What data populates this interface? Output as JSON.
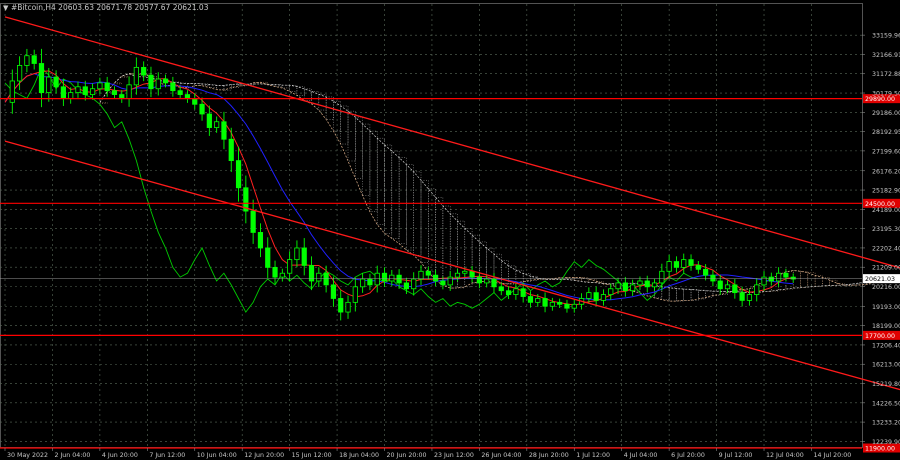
{
  "header": {
    "symbol_info": "#Bitcoin,H4  20603.63 20671.78 20577.67 20621.03"
  },
  "colors": {
    "background": "#000000",
    "grid": "#5a6a5a",
    "axis_text": "#c8c8c8",
    "level_line": "#ff0000",
    "channel_line": "#ff1a1a",
    "bull_candle": "#00ff00",
    "bear_candle": "#00ff00",
    "chikou": "#00cc00",
    "tenkan": "#ff2020",
    "kijun": "#2020ff",
    "cloud_a": "#e8b890",
    "cloud_b": "#d8d8d8",
    "current_price_box": "#ffffff",
    "level_box": "#e00000"
  },
  "chart_data": {
    "type": "candlestick",
    "instrument": "#Bitcoin",
    "timeframe": "H4",
    "ohlc_last": {
      "open": 20603.63,
      "high": 20671.78,
      "low": 20577.67,
      "close": 20621.03
    },
    "y_range": [
      11900,
      34300
    ],
    "y_ticks": [
      33159.96,
      32166.91,
      31172.88,
      30179.5,
      29186.0,
      28192.95,
      27199.6,
      26176.2,
      25182.9,
      24189.0,
      23195.3,
      22202.4,
      21209.0,
      20216.0,
      19193.0,
      18199.0,
      17206.4,
      16213.0,
      15219.8,
      14226.5,
      13233.2,
      12239.9
    ],
    "y_tick_labels": [
      "33159.96",
      "32166.91",
      "31172.88",
      "30179.50",
      "29186.00",
      "28192.95",
      "27199.60",
      "26176.20",
      "25182.90",
      "24189.00",
      "23195.30",
      "22202.40",
      "21209.00",
      "20216.00",
      "19193.00",
      "18199.00",
      "17206.40",
      "16213.00",
      "15219.80",
      "14226.50",
      "13233.20",
      "12239.90"
    ],
    "current_price": 20621.03,
    "current_price_label": "20621.03",
    "horizontal_levels": [
      {
        "price": 29890.0,
        "label": "29890.00"
      },
      {
        "price": 24500.0,
        "label": "24500.00"
      },
      {
        "price": 17700.0,
        "label": "17700.00"
      },
      {
        "price": 11900.0,
        "label": "11900.00"
      }
    ],
    "x_tick_labels": [
      "30 May 2022",
      "2 Jun 04:00",
      "4 Jun 20:00",
      "7 Jun 12:00",
      "10 Jun 04:00",
      "12 Jun 20:00",
      "15 Jun 12:00",
      "18 Jun 04:00",
      "20 Jun 20:00",
      "23 Jun 12:00",
      "26 Jun 04:00",
      "28 Jun 20:00",
      "1 Jul 12:00",
      "4 Jul 04:00",
      "6 Jul 20:00",
      "9 Jul 12:00",
      "12 Jul 04:00",
      "14 Jul 20:00"
    ],
    "x_domain": [
      0,
      228
    ],
    "x_tick_positions": [
      0,
      13,
      26,
      39,
      52,
      65,
      78,
      91,
      104,
      117,
      130,
      143,
      156,
      169,
      182,
      195,
      208,
      221
    ],
    "trend_lines": [
      {
        "name": "upper-channel",
        "points": [
          [
            0,
            34100
          ],
          [
            260,
            20400
          ]
        ]
      },
      {
        "name": "lower-channel",
        "points": [
          [
            0,
            27700
          ],
          [
            255,
            14400
          ]
        ]
      }
    ],
    "close_path": [
      [
        0,
        29700
      ],
      [
        2,
        30800
      ],
      [
        4,
        31600
      ],
      [
        6,
        32100
      ],
      [
        8,
        31700
      ],
      [
        10,
        30200
      ],
      [
        12,
        31000
      ],
      [
        14,
        30500
      ],
      [
        16,
        29900
      ],
      [
        18,
        30200
      ],
      [
        20,
        30500
      ],
      [
        22,
        30100
      ],
      [
        24,
        30400
      ],
      [
        26,
        30700
      ],
      [
        28,
        30300
      ],
      [
        30,
        30100
      ],
      [
        32,
        29900
      ],
      [
        34,
        30600
      ],
      [
        36,
        31500
      ],
      [
        38,
        31100
      ],
      [
        40,
        30400
      ],
      [
        42,
        30900
      ],
      [
        44,
        30700
      ],
      [
        46,
        30300
      ],
      [
        48,
        30100
      ],
      [
        50,
        29900
      ],
      [
        52,
        29600
      ],
      [
        54,
        29100
      ],
      [
        56,
        28400
      ],
      [
        58,
        28700
      ],
      [
        60,
        27800
      ],
      [
        62,
        26700
      ],
      [
        64,
        25300
      ],
      [
        66,
        24100
      ],
      [
        68,
        23000
      ],
      [
        70,
        22200
      ],
      [
        72,
        21200
      ],
      [
        74,
        20700
      ],
      [
        76,
        20900
      ],
      [
        78,
        21600
      ],
      [
        80,
        22200
      ],
      [
        82,
        21300
      ],
      [
        84,
        20500
      ],
      [
        86,
        20900
      ],
      [
        88,
        20300
      ],
      [
        90,
        19600
      ],
      [
        92,
        18900
      ],
      [
        94,
        19400
      ],
      [
        96,
        20200
      ],
      [
        98,
        20600
      ],
      [
        100,
        20300
      ],
      [
        102,
        20900
      ],
      [
        104,
        20500
      ],
      [
        106,
        20800
      ],
      [
        108,
        20400
      ],
      [
        110,
        20100
      ],
      [
        112,
        20600
      ],
      [
        114,
        21000
      ],
      [
        116,
        20800
      ],
      [
        118,
        20500
      ],
      [
        120,
        20300
      ],
      [
        122,
        20700
      ],
      [
        124,
        20900
      ],
      [
        126,
        21000
      ],
      [
        128,
        20700
      ],
      [
        130,
        20400
      ],
      [
        132,
        20600
      ],
      [
        134,
        20200
      ],
      [
        136,
        20000
      ],
      [
        138,
        19800
      ],
      [
        140,
        20100
      ],
      [
        142,
        19700
      ],
      [
        144,
        19400
      ],
      [
        146,
        19600
      ],
      [
        148,
        19200
      ],
      [
        150,
        19400
      ],
      [
        152,
        19300
      ],
      [
        154,
        19100
      ],
      [
        156,
        19300
      ],
      [
        158,
        19600
      ],
      [
        160,
        19900
      ],
      [
        162,
        19500
      ],
      [
        164,
        19800
      ],
      [
        166,
        20100
      ],
      [
        168,
        20400
      ],
      [
        170,
        20000
      ],
      [
        172,
        20300
      ],
      [
        174,
        20500
      ],
      [
        176,
        20200
      ],
      [
        178,
        20400
      ],
      [
        180,
        21000
      ],
      [
        182,
        21500
      ],
      [
        184,
        21200
      ],
      [
        186,
        21600
      ],
      [
        188,
        21300
      ],
      [
        190,
        21100
      ],
      [
        192,
        20800
      ],
      [
        194,
        20500
      ],
      [
        196,
        20100
      ],
      [
        198,
        20300
      ],
      [
        200,
        19900
      ],
      [
        202,
        19500
      ],
      [
        204,
        19800
      ],
      [
        206,
        20300
      ],
      [
        208,
        20700
      ],
      [
        210,
        20500
      ],
      [
        212,
        20900
      ],
      [
        214,
        20700
      ],
      [
        216,
        20600
      ]
    ],
    "grid": true
  }
}
